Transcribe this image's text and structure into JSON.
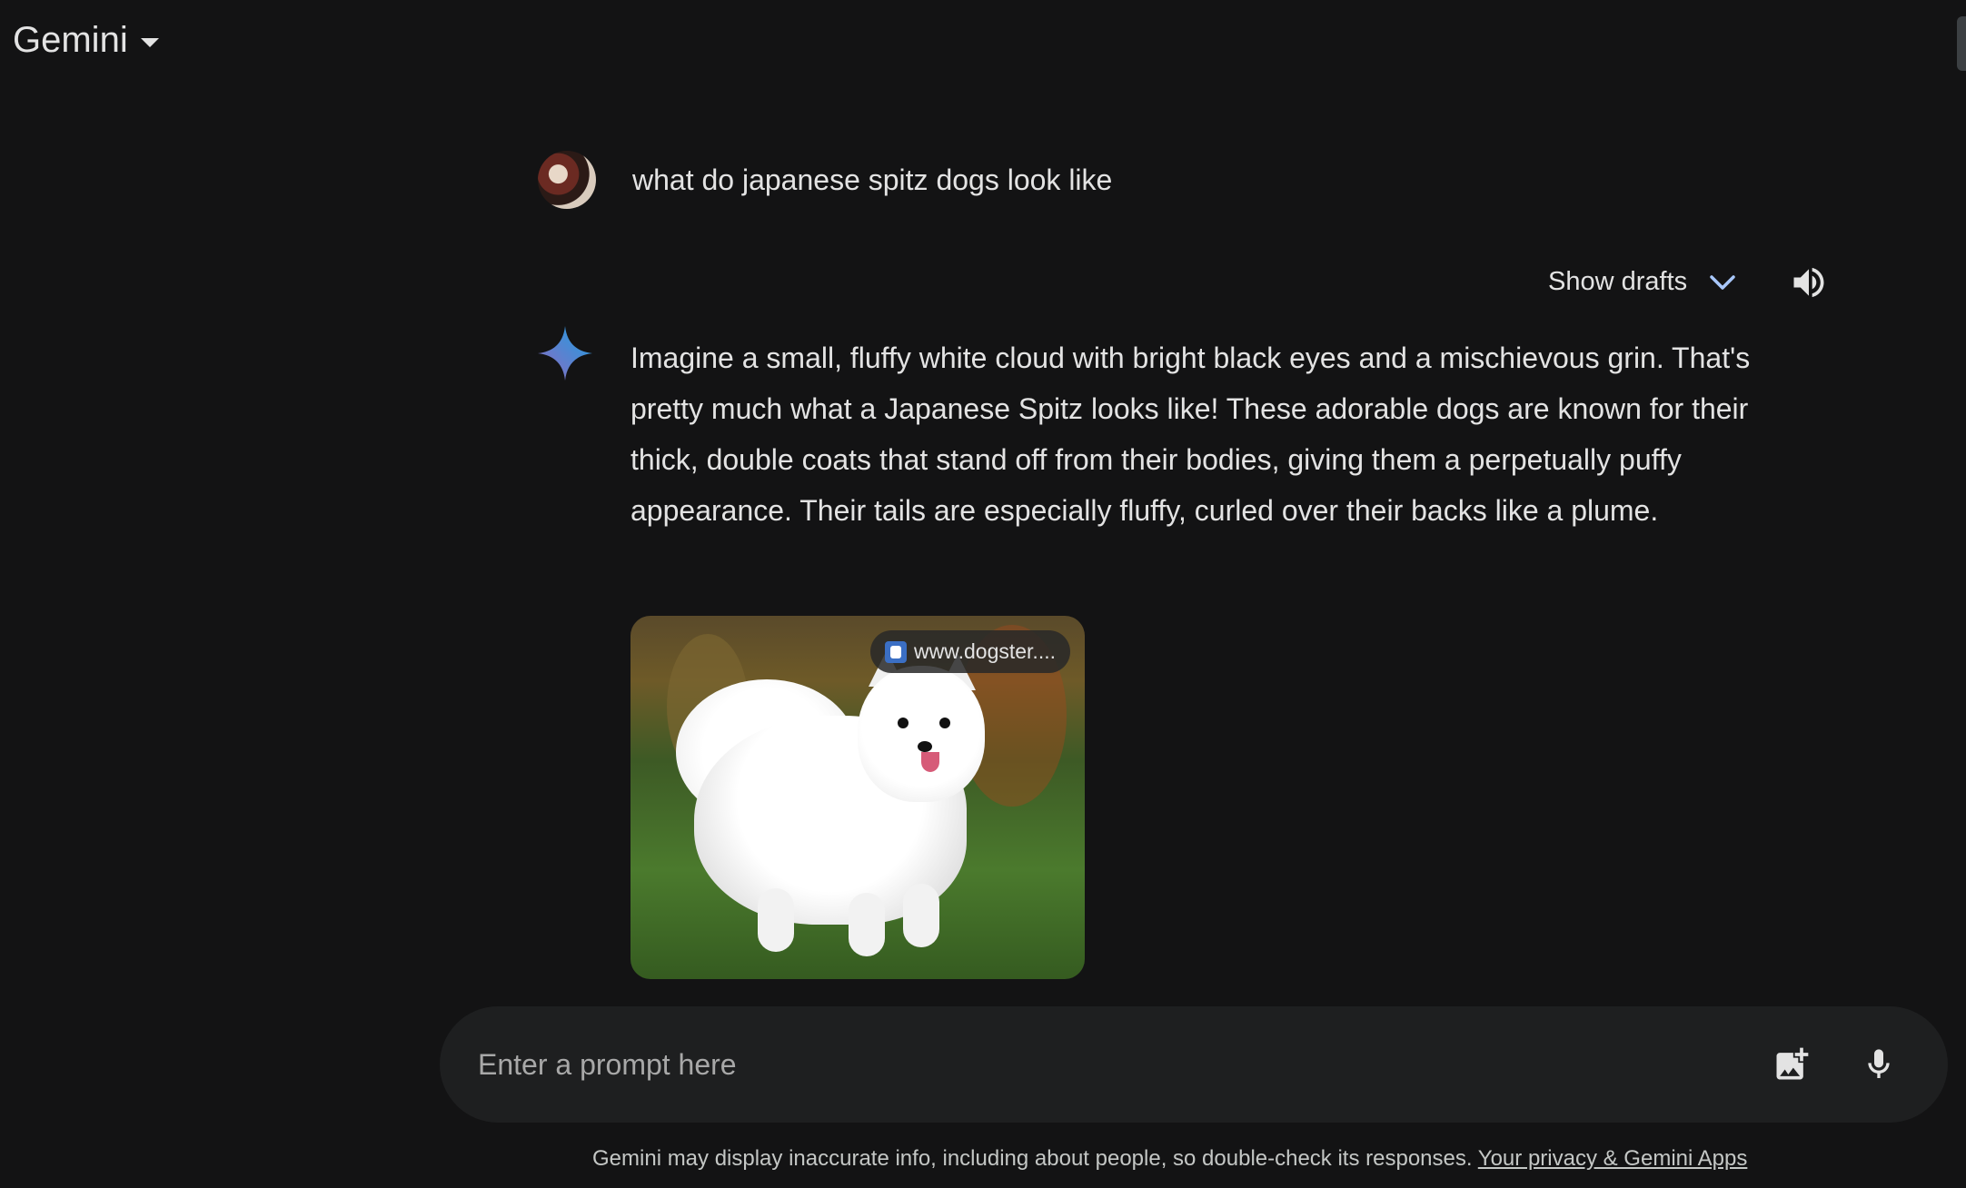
{
  "header": {
    "app_title": "Gemini"
  },
  "conversation": {
    "user_query": "what do japanese spitz dogs look like",
    "show_drafts_label": "Show drafts",
    "response_text": "Imagine a small, fluffy white cloud with bright black eyes and a mischievous grin. That's pretty much what a Japanese Spitz looks like! These adorable dogs are known for their thick, double coats that stand off from their bodies, giving them a perpetually puffy appearance. Their tails are especially fluffy, curled over their backs like a plume.",
    "image": {
      "source_label": "www.dogster...."
    }
  },
  "prompt": {
    "placeholder": "Enter a prompt here"
  },
  "footer": {
    "disclaimer": "Gemini may display inaccurate info, including about people, so double-check its responses.",
    "privacy_link": "Your privacy & Gemini Apps"
  },
  "colors": {
    "background": "#131314",
    "prompt_bar": "#1e1f20",
    "text": "#e3e3e3",
    "accent_chevron": "#a8c7fa"
  },
  "icons": [
    "chevron-down-icon",
    "speaker-icon",
    "gemini-sparkle-icon",
    "add-image-icon",
    "microphone-icon"
  ]
}
